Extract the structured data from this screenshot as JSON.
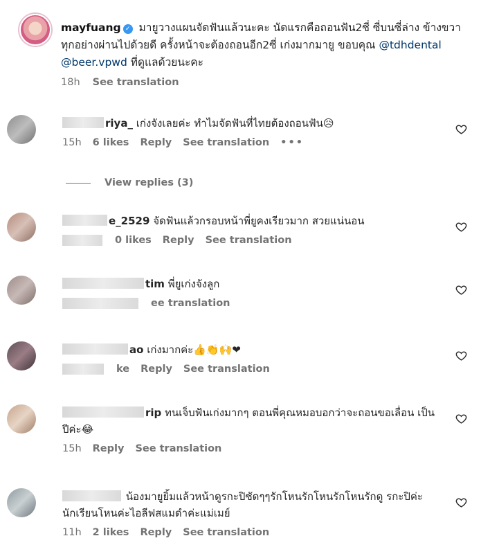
{
  "post": {
    "username": "mayfuang",
    "text": "มายูวางแผนจัดฟันแล้วนะคะ นัดแรกคือถอนฟัน2ซี่ ซี่บนซี่ล่าง ข้างขวา ทุกอย่างผ่านไปด้วยดี ครั้งหน้าจะต้องถอนอีก2ซี่ เก่งมากมายู ขอบคุณ",
    "mention1": "@tdhdental",
    "mention2": "@beer.vpwd",
    "tail": "ที่ดูแลด้วยนะคะ",
    "time": "18h",
    "see_translation": "See translation"
  },
  "comments": [
    {
      "user": "riya_",
      "text": "เก่งจังเลยค่ะ ทำไมจัดฟันที่ไทยต้องถอนฟัน😥",
      "time": "15h",
      "likes": "6 likes",
      "reply": "Reply",
      "see_translation": "See translation",
      "more": "•••"
    },
    {
      "user": "e_2529",
      "text": "จัดฟันแล้วกรอบหน้าพี่ยูคงเรียวมาก สวยแน่นอน",
      "time": "",
      "likes": "0 likes",
      "reply": "Reply",
      "see_translation": "See translation"
    },
    {
      "user": "tim",
      "text": "พี่ยูเก่งจังลูก",
      "time": "",
      "likes": "",
      "reply": "",
      "see_translation": "ee translation"
    },
    {
      "user": "ao",
      "text": "เก่งมากค่ะ👍👏🙌❤",
      "time": "",
      "likes": "ke",
      "reply": "Reply",
      "see_translation": "See translation"
    },
    {
      "user": "rip",
      "text": "ทนเจ็บฟันเก่งมากๆ ตอนพี่คุณหมอบอกว่าจะถอนขอเลื่อน เป็นปีค่ะ😂",
      "time": "15h",
      "likes": "",
      "reply": "Reply",
      "see_translation": "See translation"
    },
    {
      "user": "",
      "text": "น้องมายูยิ้มแล้วหน้าดูรกะปิซัดๆๆรักโหนรักโหนรักโหนรักดู รกะปิค่ะนักเรียนโหนค่ะไอลีฟสแมดำค่ะแม่เมย์",
      "time": "11h",
      "likes": "2 likes",
      "reply": "Reply",
      "see_translation": "See translation"
    }
  ],
  "view_replies": "View replies (3)"
}
